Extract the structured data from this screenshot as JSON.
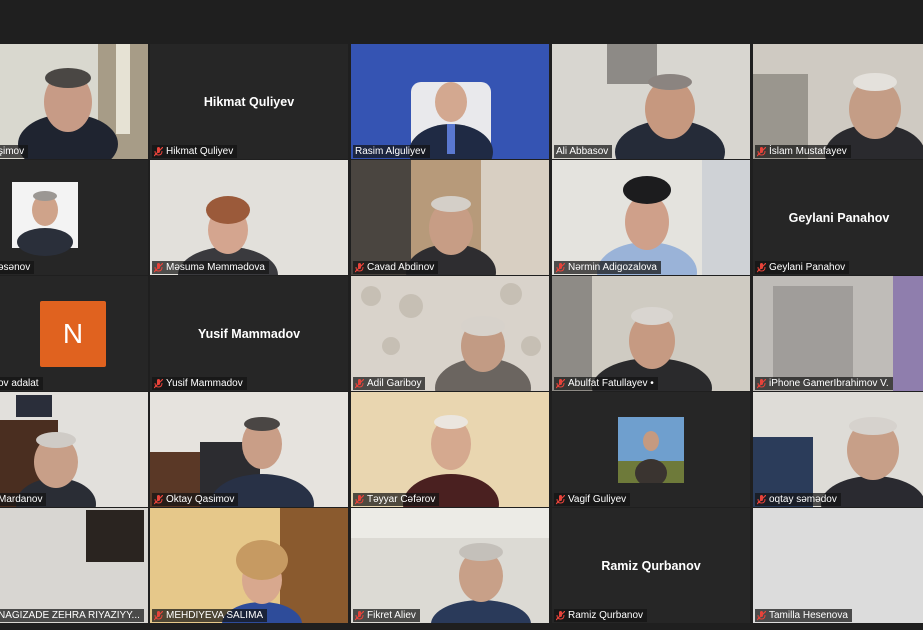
{
  "meeting": {
    "tiles": [
      {
        "name": "Ramiz Qasimov",
        "label": "şimov"
      },
      {
        "name": "Hikmat Quliyev",
        "label": "Hikmat Quliyev",
        "show_name": "Hikmat Quliyev"
      },
      {
        "name": "Rasim Alguliyev",
        "label": "Rasim Alguliyev"
      },
      {
        "name": "Ali Abbasov",
        "label": "Ali Abbasov"
      },
      {
        "name": "İslam Mustafayev",
        "label": "İslam Mustafayev"
      },
      {
        "name": "Həsənov",
        "label": "əsənov"
      },
      {
        "name": "Məsumə Məmmədova",
        "label": "Məsumə Məmmədova"
      },
      {
        "name": "Cavad Abdinov",
        "label": "Cavad Abdinov"
      },
      {
        "name": "Nərmin Adigozalova",
        "label": "Nərmin Adigozalova"
      },
      {
        "name": "Geylani Panahov",
        "label": "Geylani Panahov",
        "show_name": "Geylani Panahov"
      },
      {
        "name": "adalat",
        "label": "ov adalat",
        "avatar_letter": "N"
      },
      {
        "name": "Yusif Mammadov",
        "label": "Yusif Mammadov",
        "show_name": "Yusif Mammadov"
      },
      {
        "name": "Adil Gariboy",
        "label": "Adil Gariboy"
      },
      {
        "name": "Abulfat Fatullayev",
        "label": "Abulfat Fatullayev •"
      },
      {
        "name": "iPhone GamerIbrahimov V.",
        "label": "iPhone GamerIbrahimov V."
      },
      {
        "name": "Mardanov",
        "label": "Mardanov"
      },
      {
        "name": "Oktay Qasimov",
        "label": "Oktay Qasimov"
      },
      {
        "name": "Təyyar Cəfərov",
        "label": "Təyyar Cəfərov"
      },
      {
        "name": "Vagif Guliyev",
        "label": "Vagif Guliyev"
      },
      {
        "name": "oqtay səmədov",
        "label": "oqtay səmədov"
      },
      {
        "name": "NAGIZADE ZEHRA",
        "label": "NAGIZADE ZEHRA  RIYAZIYY..."
      },
      {
        "name": "MEHDIYEVA SALIMA",
        "label": "MEHDIYEVA SALIMA"
      },
      {
        "name": "Fikret Aliev",
        "label": "Fikret Aliev"
      },
      {
        "name": "Ramiz Qurbanov",
        "label": "Ramiz Qurbanov",
        "show_name": "Ramiz Qurbanov"
      },
      {
        "name": "Tamilla Hesenova",
        "label": "Tamilla Hesenova"
      }
    ]
  },
  "colors": {
    "background": "#1f1f1f",
    "tile": "#262626",
    "active_border": "#c6e05a",
    "mic_muted": "#e8433a",
    "avatar_orange": "#e0621f"
  },
  "icons": {
    "mute": "mic-muted-icon"
  }
}
